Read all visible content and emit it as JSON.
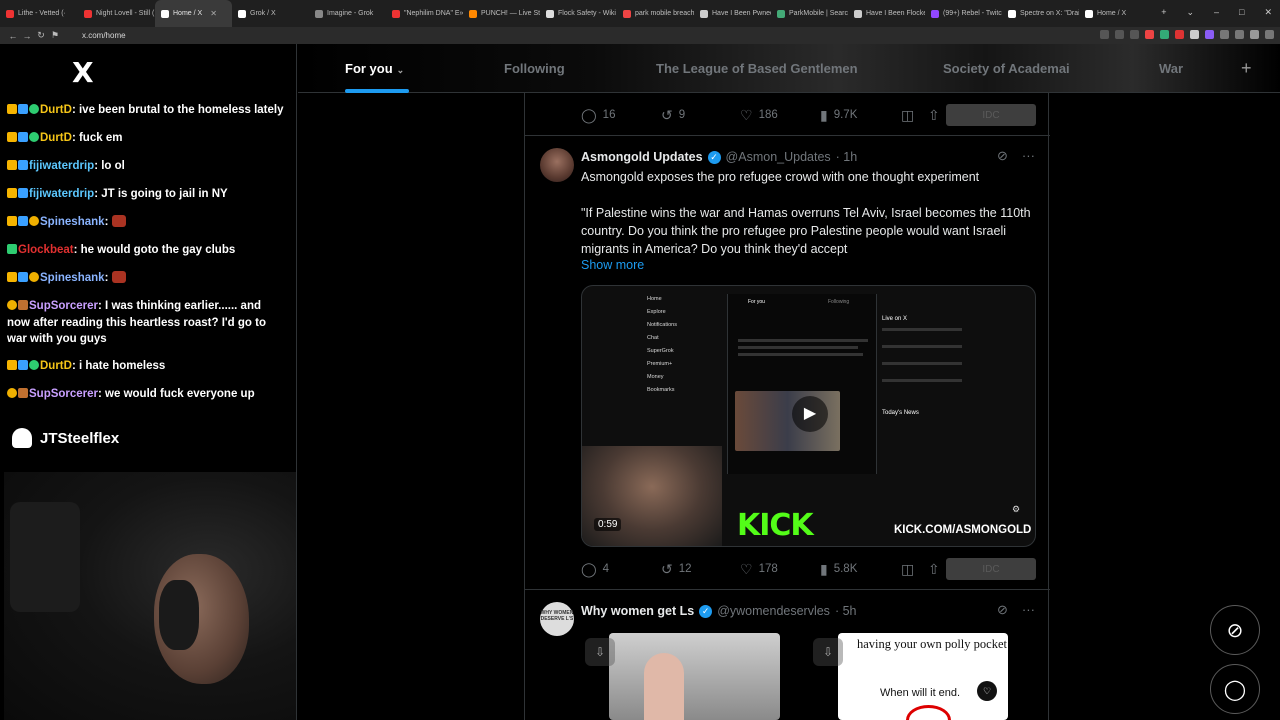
{
  "browser": {
    "tabs": [
      {
        "label": "Lithe - Vetted (·",
        "color": "#e33"
      },
      {
        "label": "Night Lovell - Still (",
        "color": "#e33"
      },
      {
        "label": "Home / X",
        "color": "#fff",
        "active": true
      },
      {
        "label": "Grok / X",
        "color": "#fff"
      },
      {
        "label": "Imagine - Grok",
        "color": "#888"
      },
      {
        "label": "\"Nephilim DNA\" E»",
        "color": "#e33"
      },
      {
        "label": "PUNCH! — Live Str",
        "color": "#f80"
      },
      {
        "label": "Flock Safety - Wiki",
        "color": "#ddd"
      },
      {
        "label": "park mobile breach",
        "color": "#e44"
      },
      {
        "label": "Have I Been Pwned",
        "color": "#ccc"
      },
      {
        "label": "ParkMobile | Search",
        "color": "#4a7"
      },
      {
        "label": "Have I Been Flocke",
        "color": "#ccc"
      },
      {
        "label": "(99+) Rebel - Twitch",
        "color": "#9147ff"
      },
      {
        "label": "Spectre on X: \"Drai",
        "color": "#fff"
      },
      {
        "label": "Home / X",
        "color": "#fff"
      }
    ],
    "url": "x.com/home"
  },
  "stream": {
    "chat": [
      {
        "user": "DurtD",
        "color": "#f5c518",
        "text": ": ive been brutal to the homeless lately",
        "badges": [
          "crown",
          "grid",
          "heart"
        ]
      },
      {
        "user": "DurtD",
        "color": "#f5c518",
        "text": ": fuck em",
        "badges": [
          "crown",
          "grid",
          "heart"
        ]
      },
      {
        "user": "fijiwaterdrip",
        "color": "#5cc8ff",
        "text": ": lo ol",
        "badges": [
          "crown",
          "grid"
        ]
      },
      {
        "user": "fijiwaterdrip",
        "color": "#5cc8ff",
        "text": ": JT is going to jail in NY",
        "badges": [
          "crown",
          "grid"
        ]
      },
      {
        "user": "Spineshank",
        "color": "#8ab4ff",
        "text": ": ",
        "badges": [
          "crown",
          "grid",
          "coin"
        ],
        "emote": true
      },
      {
        "user": "Glockbeat",
        "color": "#e03030",
        "text": ": he would goto the gay clubs",
        "badges": [
          "gift"
        ]
      },
      {
        "user": "Spineshank",
        "color": "#8ab4ff",
        "text": ": ",
        "badges": [
          "crown",
          "grid",
          "coin"
        ],
        "emote": true
      },
      {
        "user": "SupSorcerer",
        "color": "#c9a0ff",
        "text": ": I was thinking earlier...... and now after reading this heartless roast? I'd go to war with you guys",
        "badges": [
          "coin",
          "box"
        ]
      },
      {
        "user": "DurtD",
        "color": "#f5c518",
        "text": ": i hate homeless",
        "badges": [
          "crown",
          "grid",
          "heart"
        ]
      },
      {
        "user": "SupSorcerer",
        "color": "#c9a0ff",
        "text": ": we would fuck everyone up",
        "badges": [
          "coin",
          "box"
        ]
      }
    ],
    "streamer_name": "JTSteelflex"
  },
  "x": {
    "logo": "X",
    "tabs": [
      "For you",
      "Following",
      "The League of Based Gentlemen",
      "Society of Academai",
      "War"
    ],
    "prev_post_stats": {
      "replies": "16",
      "reposts": "9",
      "likes": "186",
      "views": "9.7K"
    },
    "grok_label": "IDC",
    "post1": {
      "name": "Asmongold Updates",
      "handle": "@Asmon_Updates",
      "time": "· 1h",
      "text1": "Asmongold exposes the pro refugee crowd with one thought experiment",
      "text2": "\"If Palestine wins the war and Hamas overruns Tel Aviv, Israel becomes the 110th country. Do you think the pro refugee pro Palestine people would want Israeli migrants in America? Do you think they'd accept",
      "show_more": "Show more",
      "video_duration": "0:59",
      "kick_brand": "KICK",
      "kick_url": "KICK.COM/ASMONGOLD",
      "stats": {
        "replies": "4",
        "reposts": "12",
        "likes": "178",
        "views": "5.8K"
      }
    },
    "inner_screenshot": {
      "nav": [
        "Home",
        "Explore",
        "Notifications",
        "Chat",
        "SuperGrok",
        "Premium+",
        "Money",
        "Bookmarks"
      ],
      "inner_tab": "For you",
      "inner_tab2": "Following",
      "live_title": "Live on X",
      "news_title": "Today's News"
    },
    "post2": {
      "name": "Why women get Ls",
      "handle": "@ywomendeservles",
      "time": "· 5h",
      "avatar_text": "WHY WOMEN DESERVE L'S",
      "image2_text1": "having your own polly pocket",
      "image2_text2": "When will it end."
    }
  }
}
